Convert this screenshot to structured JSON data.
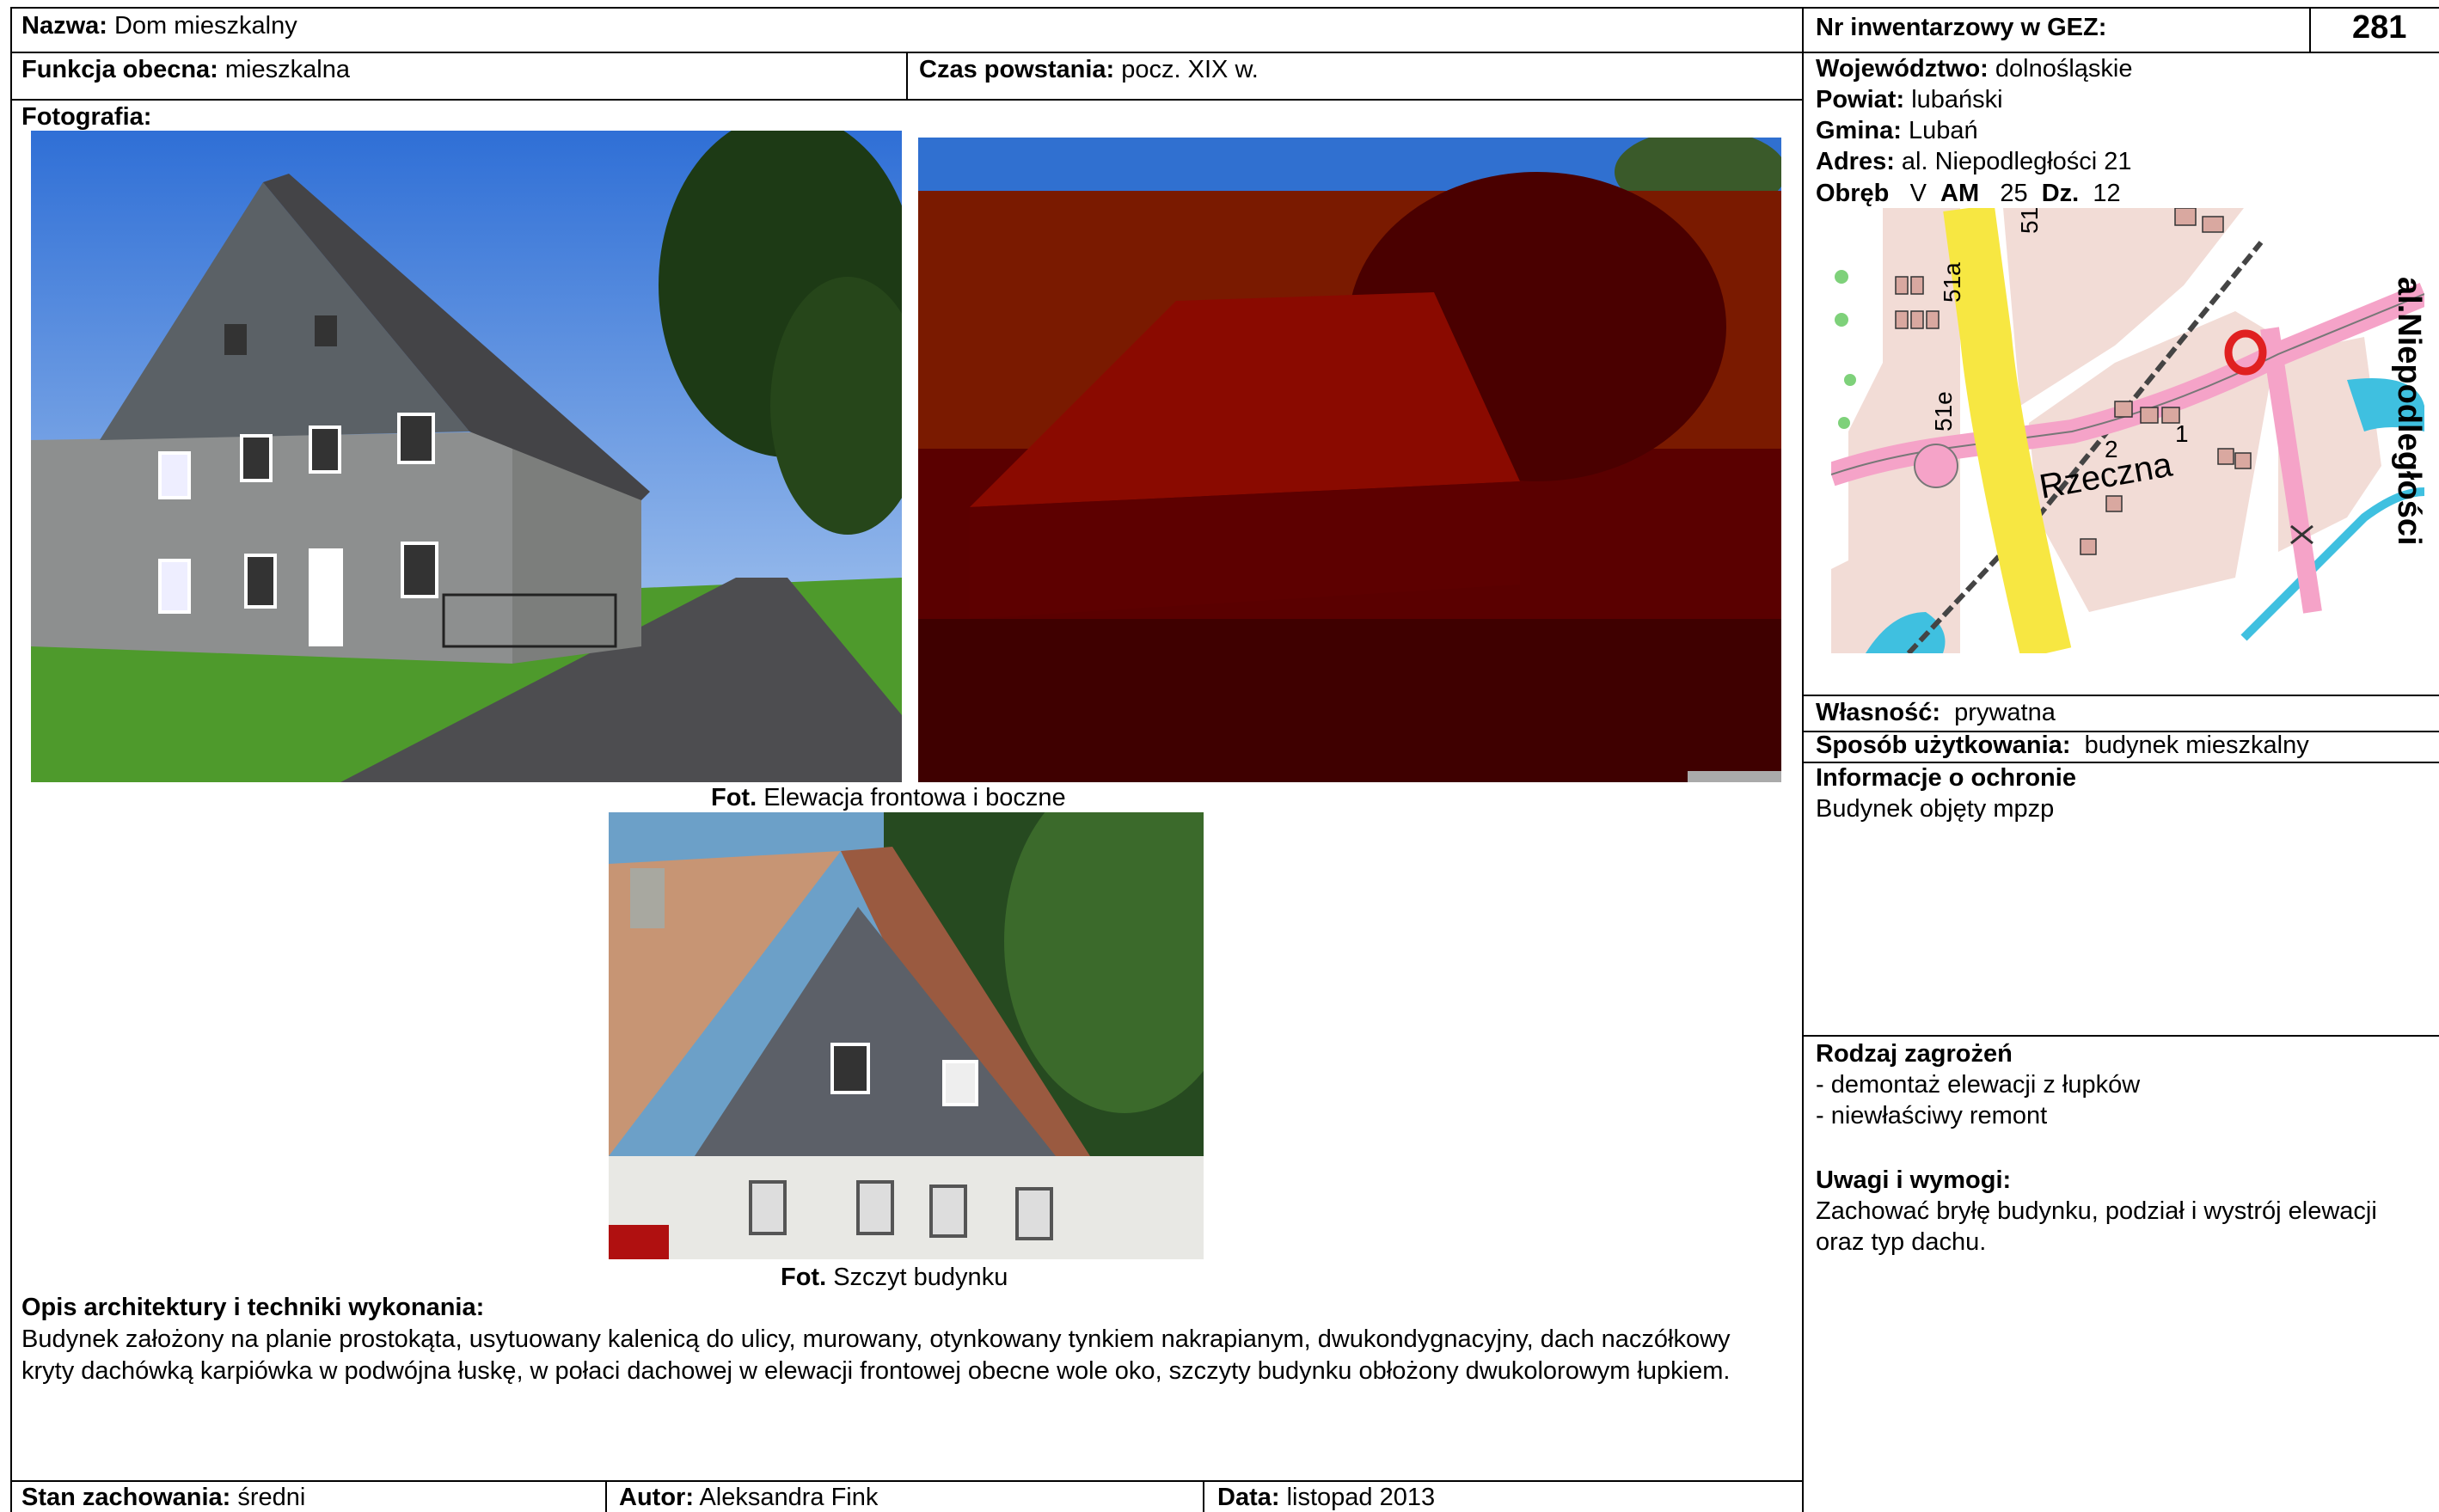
{
  "header": {
    "nazwa_label": "Nazwa:",
    "nazwa_value": "Dom mieszkalny",
    "nr_label": "Nr inwentarzowy w GEZ:",
    "nr_value": "281"
  },
  "row2": {
    "funkcja_label": "Funkcja obecna:",
    "funkcja_value": "mieszkalna",
    "czas_label": "Czas powstania:",
    "czas_value": "pocz. XIX w."
  },
  "location": {
    "woj_label": "Województwo:",
    "woj_value": "dolnośląskie",
    "powiat_label": "Powiat:",
    "powiat_value": "lubański",
    "gmina_label": "Gmina:",
    "gmina_value": "Lubań",
    "adres_label": "Adres:",
    "adres_value": "al. Niepodległości 21",
    "obreb_label": "Obręb",
    "obreb_value": "V",
    "am_label": "AM",
    "am_value": "25",
    "dz_label": "Dz.",
    "dz_value": "12"
  },
  "map": {
    "street_rzeczna": "Rzeczna",
    "street_niepodleglosci": "al.Niepodległości",
    "plot_51a": "51a",
    "plot_51e": "51e",
    "plot_51": "51",
    "plot_2": "2",
    "plot_1": "1"
  },
  "photos": {
    "label": "Fotografia:",
    "caption1_label": "Fot.",
    "caption1_text": "Elewacja frontowa i boczne",
    "caption2_label": "Fot.",
    "caption2_text": "Szczyt budynku"
  },
  "opis": {
    "title": "Opis architektury i techniki wykonania:",
    "text": "Budynek założony na planie prostokąta, usytuowany kalenicą do ulicy, murowany, otynkowany tynkiem nakrapianym, dwukondygnacyjny, dach naczółkowy kryty dachówką karpiówka w podwójna łuskę, w połaci dachowej w elewacji frontowej obecne wole oko, szczyty budynku obłożony dwukolorowym łupkiem."
  },
  "footer": {
    "stan_label": "Stan zachowania:",
    "stan_value": "średni",
    "autor_label": "Autor:",
    "autor_value": "Aleksandra Fink",
    "data_label": "Data:",
    "data_value": "listopad 2013"
  },
  "right": {
    "wlasnosc_label": "Własność:",
    "wlasnosc_value": "prywatna",
    "sposob_label": "Sposób użytkowania:",
    "sposob_value": "budynek mieszkalny",
    "ochrona_title": "Informacje o ochronie",
    "ochrona_text": "Budynek objęty mpzp",
    "zagrozenia_title": "Rodzaj zagrożeń",
    "zagrozenia_items": [
      "- demontaż elewacji z łupków",
      "- niewłaściwy remont"
    ],
    "uwagi_title": "Uwagi i wymogi:",
    "uwagi_lines": [
      "Zachować bryłę budynku, podział i wystrój elewacji",
      "oraz typ dachu."
    ]
  }
}
